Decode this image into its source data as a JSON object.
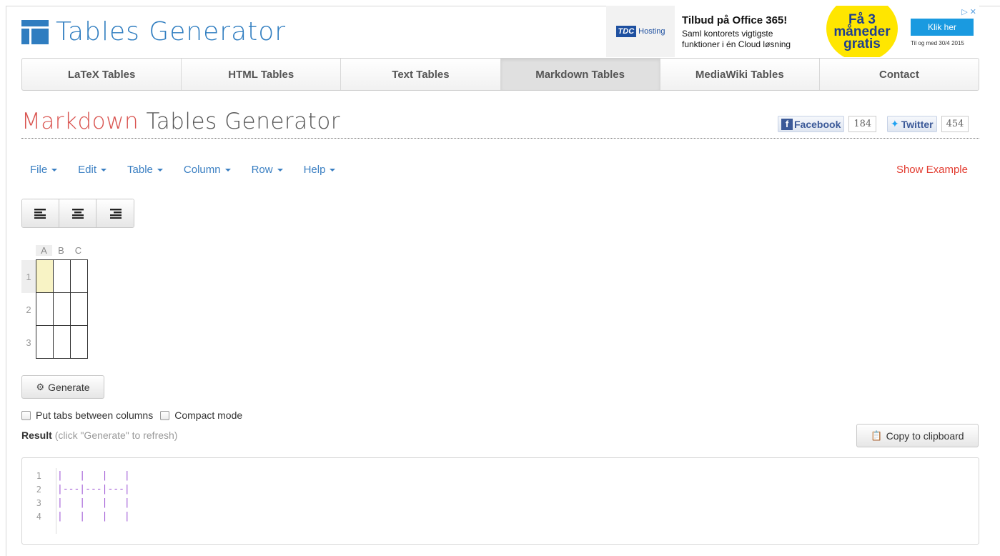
{
  "site": {
    "logo_text": "Tables Generator"
  },
  "ad": {
    "brand": "TDC",
    "brand_sub": "Hosting",
    "title": "Tilbud på Office 365!",
    "line1": "Saml kontorets vigtigste",
    "line2": "funktioner i én Cloud løsning",
    "promo1": "Få 3",
    "promo2": "måneder",
    "promo3": "gratis",
    "button": "Klik her",
    "date": "Til og med 30/4 2015",
    "close": "▷ ✕"
  },
  "nav": {
    "items": [
      "LaTeX Tables",
      "HTML Tables",
      "Text Tables",
      "Markdown Tables",
      "MediaWiki Tables",
      "Contact"
    ],
    "active_index": 3
  },
  "page": {
    "title_accent": "Markdown",
    "title_rest": " Tables Generator"
  },
  "social": {
    "facebook_label": "Facebook",
    "facebook_count": "184",
    "twitter_label": "Twitter",
    "twitter_count": "454"
  },
  "menu": {
    "items": [
      "File",
      "Edit",
      "Table",
      "Column",
      "Row",
      "Help"
    ],
    "show_example": "Show Example"
  },
  "grid": {
    "columns": [
      "A",
      "B",
      "C"
    ],
    "rows": [
      "1",
      "2",
      "3"
    ]
  },
  "generate": {
    "label": "Generate"
  },
  "options": {
    "tabs_label": "Put tabs between columns",
    "compact_label": "Compact mode"
  },
  "result": {
    "label": "Result",
    "hint": "(click \"Generate\" to refresh)",
    "copy_label": "Copy to clipboard"
  },
  "code": {
    "lines": [
      {
        "num": "1",
        "text": "|   |   |   |"
      },
      {
        "num": "2",
        "text": "|---|---|---|"
      },
      {
        "num": "3",
        "text": "|   |   |   |"
      },
      {
        "num": "4",
        "text": "|   |   |   |"
      }
    ]
  },
  "colors": {
    "brand_blue": "#2f7dc0",
    "accent_red": "#d9534f",
    "link_blue": "#3a7fc2",
    "selected_cell": "#f8f3c5"
  }
}
